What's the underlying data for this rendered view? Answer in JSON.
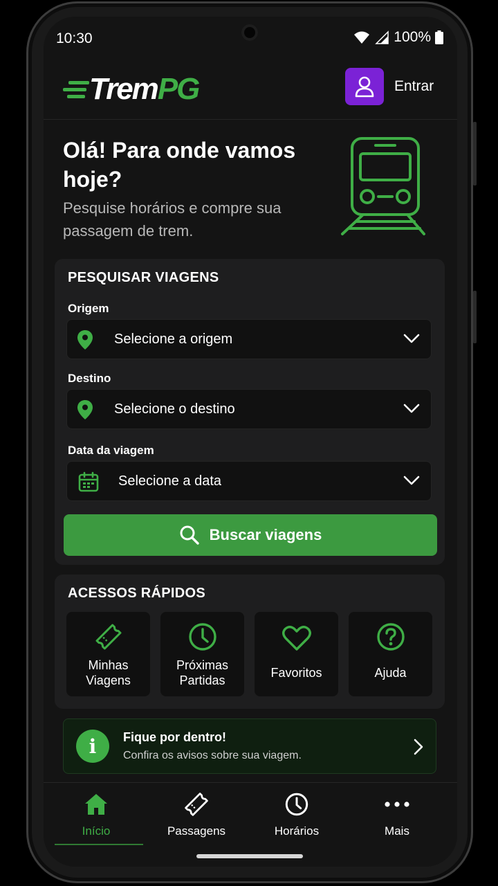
{
  "status_bar": {
    "time": "10:30",
    "battery": "100%"
  },
  "header": {
    "logo": {
      "part1": "Trem",
      "part2": "PG"
    },
    "login_label": "Entrar"
  },
  "hero": {
    "title": "Olá! Para onde vamos hoje?",
    "subtitle": "Pesquise horários e compre sua passagem de trem."
  },
  "search_card": {
    "title": "PESQUISAR VIAGENS",
    "origin": {
      "label": "Origem",
      "placeholder": "Selecione a origem",
      "icon": "location-pin-icon"
    },
    "destination": {
      "label": "Destino",
      "placeholder": "Selecione o destino",
      "icon": "location-pin-icon"
    },
    "date": {
      "label": "Data da viagem",
      "placeholder": "Selecione a data",
      "icon": "calendar-icon"
    },
    "search_button": "Buscar viagens"
  },
  "quick_access": {
    "title": "ACESSOS RÁPIDOS",
    "items": [
      {
        "label": "Minhas Viagens",
        "icon": "ticket-icon"
      },
      {
        "label": "Próximas Partidas",
        "icon": "clock-icon"
      },
      {
        "label": "Favoritos",
        "icon": "heart-icon"
      },
      {
        "label": "Ajuda",
        "icon": "help-icon"
      }
    ]
  },
  "notice": {
    "title": "Fique por dentro!",
    "subtitle": "Confira os avisos sobre sua viagem."
  },
  "bottom_nav": {
    "items": [
      {
        "label": "Início",
        "icon": "home-icon",
        "active": true
      },
      {
        "label": "Passagens",
        "icon": "ticket-icon",
        "active": false
      },
      {
        "label": "Horários",
        "icon": "clock-icon",
        "active": false
      },
      {
        "label": "Mais",
        "icon": "more-icon",
        "active": false
      }
    ]
  },
  "colors": {
    "accent": "#3fae46",
    "button": "#3c9a40",
    "login": "#7b22d6",
    "background": "#141414",
    "card": "#1e1e1f"
  }
}
